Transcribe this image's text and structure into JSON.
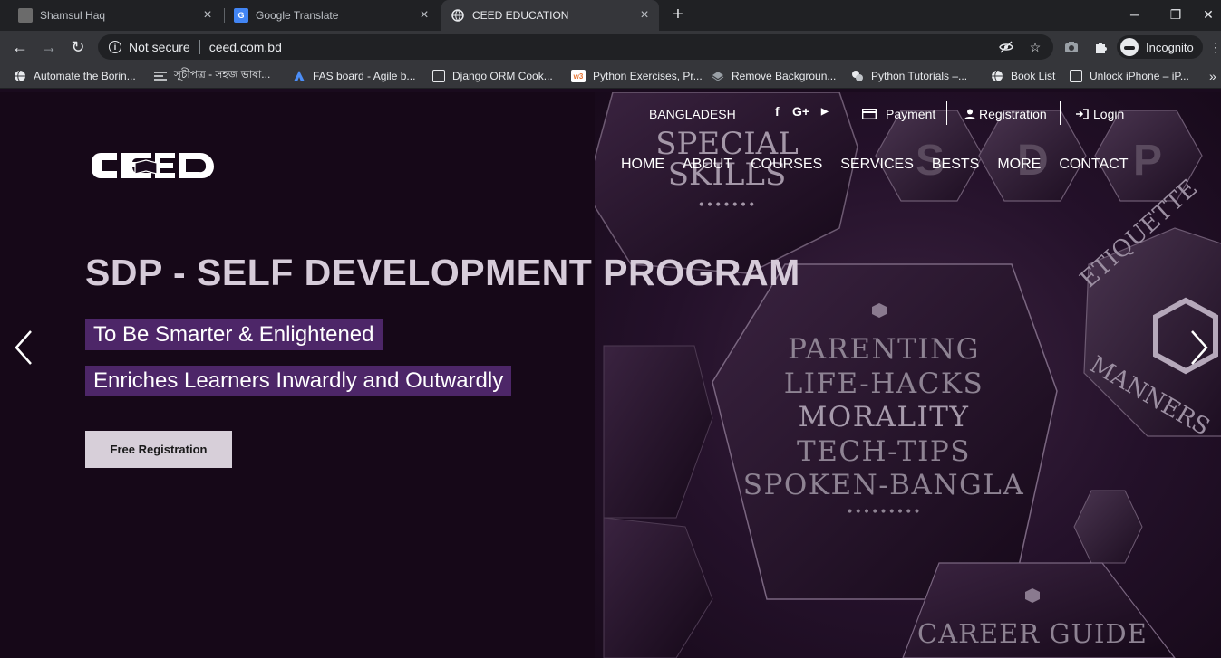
{
  "browser": {
    "tabs": [
      {
        "title": "Shamsul Haq",
        "favicon": "person-photo",
        "active": false
      },
      {
        "title": "Google Translate",
        "favicon": "google-translate-icon",
        "active": false
      },
      {
        "title": "CEED EDUCATION",
        "favicon": "globe-icon",
        "active": true
      }
    ],
    "new_tab": "+",
    "window_controls": {
      "minimize": "─",
      "maximize": "❐",
      "close": "✕"
    },
    "nav": {
      "back": "←",
      "forward": "→",
      "reload": "↻"
    },
    "omnibox": {
      "security_label": "Not secure",
      "url": "ceed.com.bd"
    },
    "profile_label": "Incognito",
    "bookmarks": [
      {
        "label": "Automate the Borin...",
        "icon": "globe-icon"
      },
      {
        "label": "সূচীপত্র - সহজ ভাষা...",
        "icon": "lines-icon"
      },
      {
        "label": "FAS board - Agile b...",
        "icon": "jira-icon"
      },
      {
        "label": "Django ORM Cook...",
        "icon": "doc-icon"
      },
      {
        "label": "Python Exercises, Pr...",
        "icon": "w3-icon"
      },
      {
        "label": "Remove Backgroun...",
        "icon": "layers-icon"
      },
      {
        "label": "Python Tutorials –...",
        "icon": "python-icon"
      },
      {
        "label": "Book List",
        "icon": "globe-icon"
      },
      {
        "label": "Unlock iPhone – iP...",
        "icon": "unlock-icon"
      }
    ],
    "bookmarks_more": "»"
  },
  "site": {
    "topbar": {
      "country": "BANGLADESH",
      "social": [
        "f",
        "G+",
        "▶"
      ],
      "payment": "Payment",
      "registration": "Registration",
      "login": "Login"
    },
    "logo_text": "CEED",
    "nav": [
      "HOME",
      "ABOUT",
      "COURSES",
      "SERVICES",
      "BESTS",
      "MORE",
      "CONTACT"
    ],
    "hero": {
      "title": "SDP - SELF DEVELOPMENT PROGRAM",
      "tagline_1": "To Be Smarter & Enlightened",
      "tagline_2": "Enriches Learners Inwardly and Outwardly",
      "cta": "Free Registration"
    },
    "hero_image_text": {
      "special_1": "SPECIAL",
      "special_2": "SKILLS",
      "letters": [
        "S",
        "D",
        "P"
      ],
      "center": [
        "PARENTING",
        "LIFE-HACKS",
        "MORALITY",
        "TECH-TIPS",
        "SPOKEN-BANGLA"
      ],
      "etiquette": "ETIQUETTE",
      "manners": "MANNERS",
      "career": "CAREER GUIDE"
    }
  }
}
